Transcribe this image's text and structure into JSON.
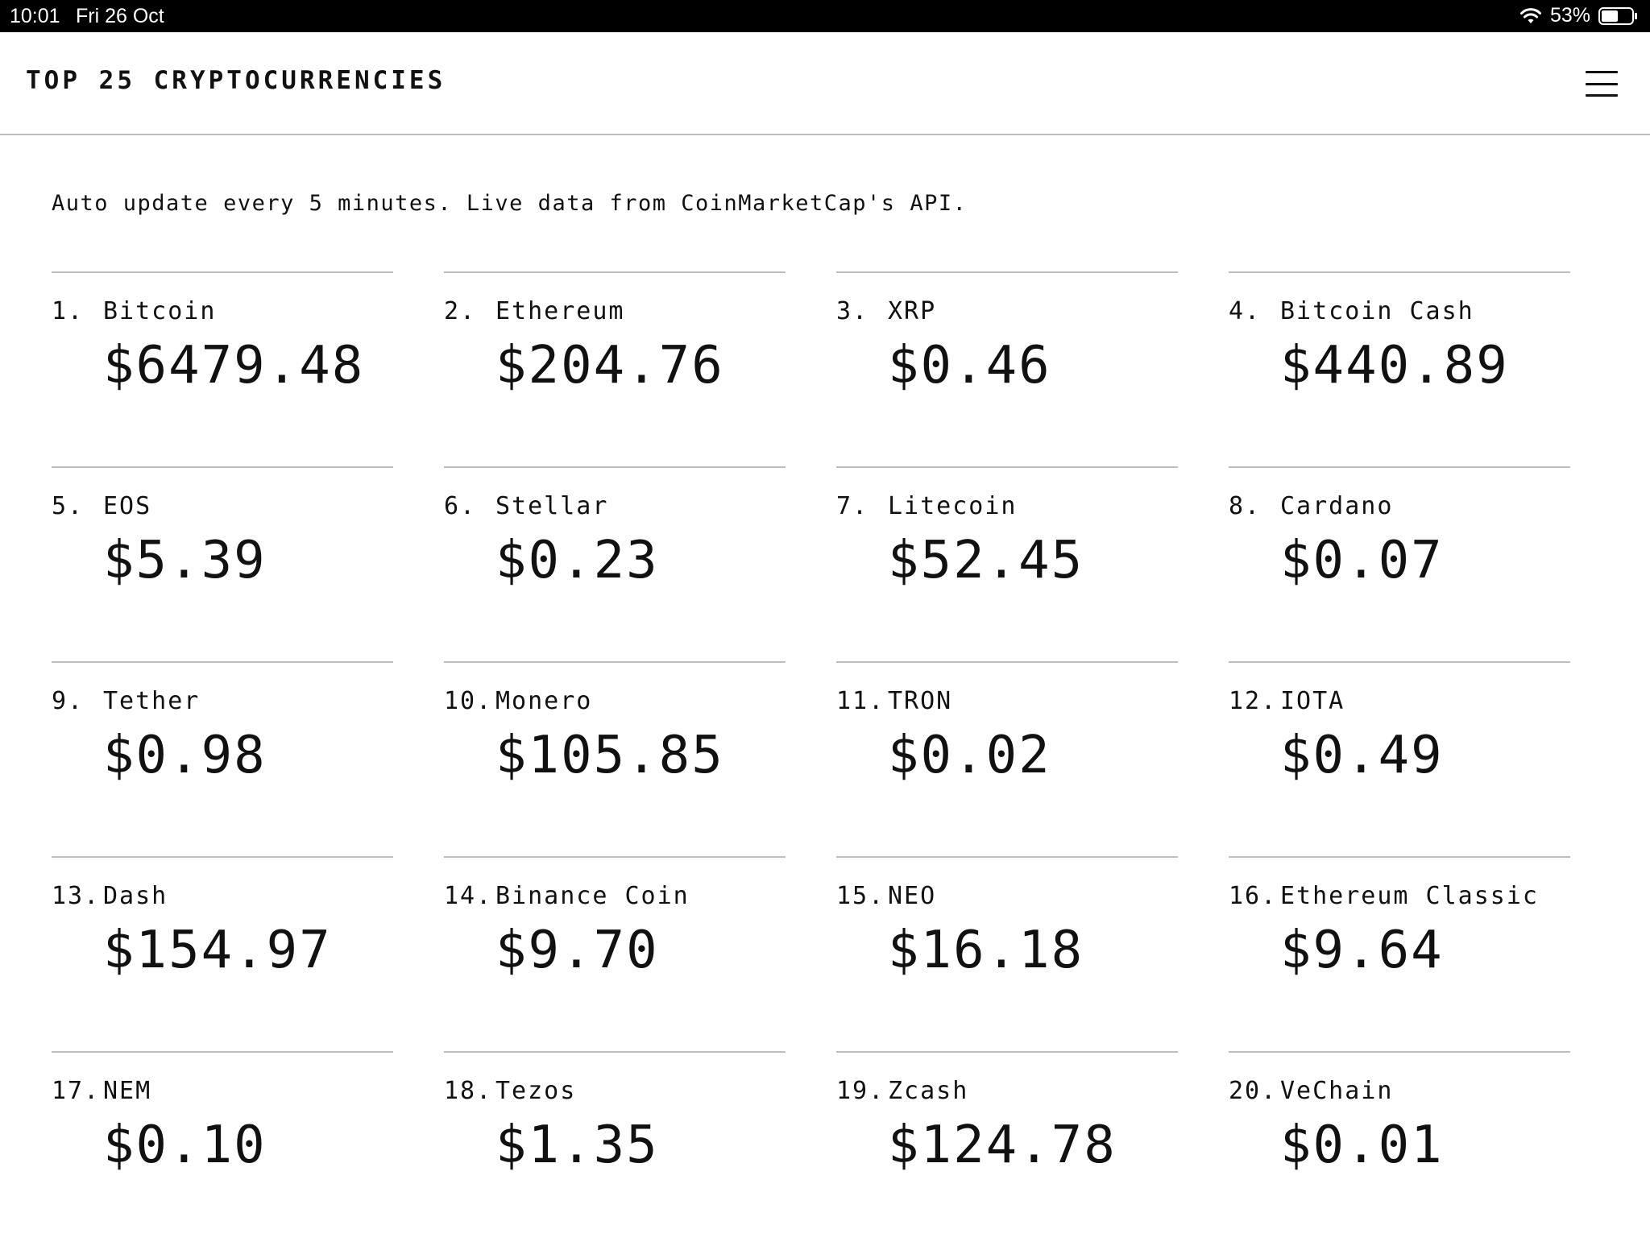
{
  "status_bar": {
    "time": "10:01",
    "date": "Fri 26 Oct",
    "battery": "53%",
    "icons": [
      "wifi-icon",
      "battery-icon"
    ]
  },
  "header": {
    "title": "TOP 25 CRYPTOCURRENCIES",
    "menu_icon": "hamburger-menu-icon"
  },
  "description": "Auto update every 5 minutes. Live data from CoinMarketCap's API.",
  "coins": [
    {
      "rank": "1.",
      "name": "Bitcoin",
      "price": "$6479.48"
    },
    {
      "rank": "2.",
      "name": "Ethereum",
      "price": "$204.76"
    },
    {
      "rank": "3.",
      "name": "XRP",
      "price": "$0.46"
    },
    {
      "rank": "4.",
      "name": "Bitcoin Cash",
      "price": "$440.89"
    },
    {
      "rank": "5.",
      "name": "EOS",
      "price": "$5.39"
    },
    {
      "rank": "6.",
      "name": "Stellar",
      "price": "$0.23"
    },
    {
      "rank": "7.",
      "name": "Litecoin",
      "price": "$52.45"
    },
    {
      "rank": "8.",
      "name": "Cardano",
      "price": "$0.07"
    },
    {
      "rank": "9.",
      "name": "Tether",
      "price": "$0.98"
    },
    {
      "rank": "10.",
      "name": "Monero",
      "price": "$105.85"
    },
    {
      "rank": "11.",
      "name": "TRON",
      "price": "$0.02"
    },
    {
      "rank": "12.",
      "name": "IOTA",
      "price": "$0.49"
    },
    {
      "rank": "13.",
      "name": "Dash",
      "price": "$154.97"
    },
    {
      "rank": "14.",
      "name": "Binance Coin",
      "price": "$9.70"
    },
    {
      "rank": "15.",
      "name": "NEO",
      "price": "$16.18"
    },
    {
      "rank": "16.",
      "name": "Ethereum Classic",
      "price": "$9.64"
    },
    {
      "rank": "17.",
      "name": "NEM",
      "price": "$0.10"
    },
    {
      "rank": "18.",
      "name": "Tezos",
      "price": "$1.35"
    },
    {
      "rank": "19.",
      "name": "Zcash",
      "price": "$124.78"
    },
    {
      "rank": "20.",
      "name": "VeChain",
      "price": "$0.01"
    }
  ],
  "colors": {
    "status_bar_bg": "#000000",
    "text": "#111111",
    "divider": "#bdbdbd",
    "background": "#ffffff"
  }
}
